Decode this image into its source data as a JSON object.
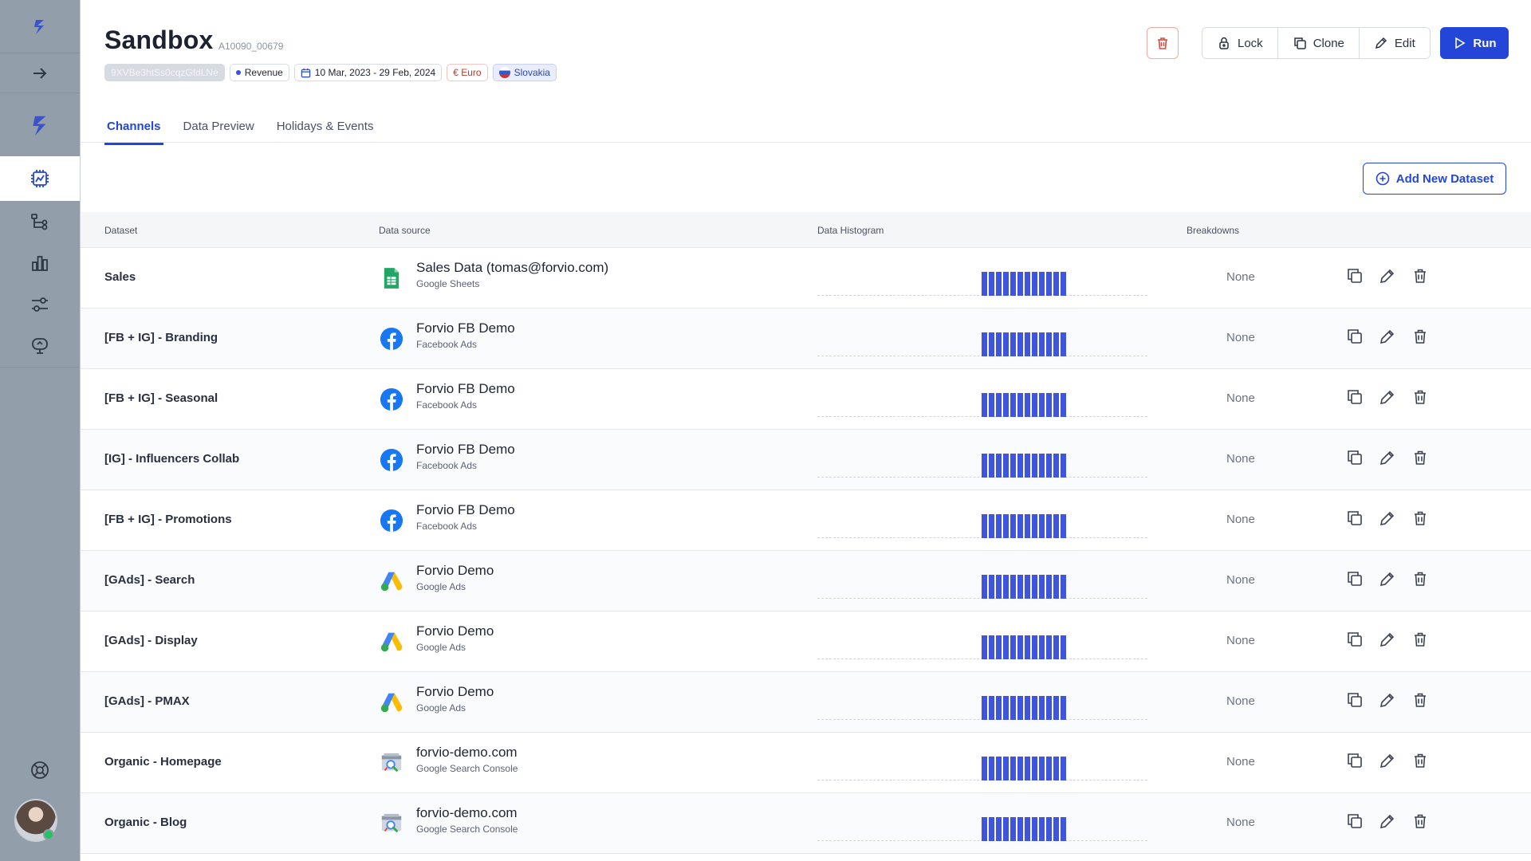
{
  "header": {
    "title": "Sandbox",
    "id": "A10090_00679",
    "tags": {
      "key": "9XVBe3htSs0cqzGfdLNe",
      "metric": "Revenue",
      "date_range": "10 Mar, 2023 - 29 Feb, 2024",
      "currency": "€ Euro",
      "country": "Slovakia"
    },
    "buttons": {
      "lock": "Lock",
      "clone": "Clone",
      "edit": "Edit",
      "run": "Run"
    }
  },
  "tabs": [
    {
      "label": "Channels",
      "active": true
    },
    {
      "label": "Data Preview",
      "active": false
    },
    {
      "label": "Holidays & Events",
      "active": false
    }
  ],
  "add_dataset_label": "Add New Dataset",
  "table": {
    "headers": {
      "dataset": "Dataset",
      "source": "Data source",
      "histogram": "Data Histogram",
      "breakdowns": "Breakdowns"
    },
    "rows": [
      {
        "dataset": "Sales",
        "source_name": "Sales Data (tomas@forvio.com)",
        "source_type": "Google Sheets",
        "icon": "sheets-icon",
        "breakdowns": "None"
      },
      {
        "dataset": "[FB + IG] - Branding",
        "source_name": "Forvio FB Demo",
        "source_type": "Facebook Ads",
        "icon": "facebook-icon",
        "breakdowns": "None"
      },
      {
        "dataset": "[FB + IG] - Seasonal",
        "source_name": "Forvio FB Demo",
        "source_type": "Facebook Ads",
        "icon": "facebook-icon",
        "breakdowns": "None"
      },
      {
        "dataset": "[IG] - Influencers Collab",
        "source_name": "Forvio FB Demo",
        "source_type": "Facebook Ads",
        "icon": "facebook-icon",
        "breakdowns": "None"
      },
      {
        "dataset": "[FB + IG] - Promotions",
        "source_name": "Forvio FB Demo",
        "source_type": "Facebook Ads",
        "icon": "facebook-icon",
        "breakdowns": "None"
      },
      {
        "dataset": "[GAds] - Search",
        "source_name": "Forvio Demo",
        "source_type": "Google Ads",
        "icon": "google-ads-icon",
        "breakdowns": "None"
      },
      {
        "dataset": "[GAds] - Display",
        "source_name": "Forvio Demo",
        "source_type": "Google Ads",
        "icon": "google-ads-icon",
        "breakdowns": "None"
      },
      {
        "dataset": "[GAds] - PMAX",
        "source_name": "Forvio Demo",
        "source_type": "Google Ads",
        "icon": "google-ads-icon",
        "breakdowns": "None"
      },
      {
        "dataset": "Organic - Homepage",
        "source_name": "forvio-demo.com",
        "source_type": "Google Search Console",
        "icon": "search-console-icon",
        "breakdowns": "None"
      },
      {
        "dataset": "Organic - Blog",
        "source_name": "forvio-demo.com",
        "source_type": "Google Search Console",
        "icon": "search-console-icon",
        "breakdowns": "None"
      }
    ]
  },
  "colors": {
    "accent": "#2446d8",
    "histogram": "#3f55dd",
    "sidebar": "#939eab",
    "danger": "#d94a3d"
  }
}
